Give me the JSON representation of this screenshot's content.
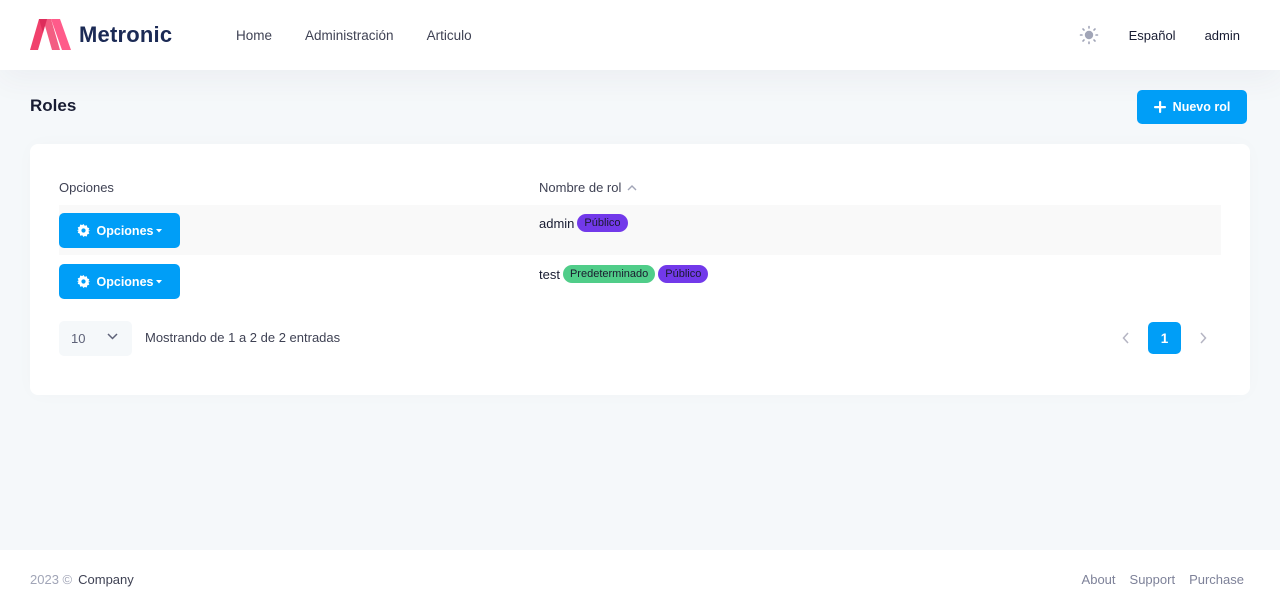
{
  "brand": {
    "name": "Metronic",
    "logo_colors": [
      "#f1416c",
      "#ff5b8a"
    ]
  },
  "nav": {
    "items": [
      {
        "label": "Home"
      },
      {
        "label": "Administración"
      },
      {
        "label": "Articulo"
      }
    ]
  },
  "header": {
    "theme_icon": "sun-icon",
    "language": "Español",
    "user": "admin"
  },
  "toolbar": {
    "title": "Roles",
    "new_button": "Nuevo rol"
  },
  "table": {
    "headers": {
      "options": "Opciones",
      "name": "Nombre de rol"
    },
    "sort": "ascending",
    "rows": [
      {
        "button": "Opciones",
        "name": "admin",
        "badges": [
          {
            "label": "Público",
            "color": "#7239ea"
          }
        ]
      },
      {
        "button": "Opciones",
        "name": "test",
        "badges": [
          {
            "label": "Predeterminado",
            "color": "#50cd89"
          },
          {
            "label": "Público",
            "color": "#7239ea"
          }
        ]
      }
    ]
  },
  "pagination": {
    "page_size": "10",
    "info": "Mostrando de 1 a 2 de 2 entradas",
    "current_page": "1"
  },
  "footer": {
    "year": "2023 ©",
    "company": "Company",
    "links": [
      {
        "label": "About"
      },
      {
        "label": "Support"
      },
      {
        "label": "Purchase"
      }
    ]
  },
  "colors": {
    "primary": "#009ef7",
    "page_bg": "#f5f8fa",
    "success": "#50cd89",
    "info": "#7239ea"
  }
}
